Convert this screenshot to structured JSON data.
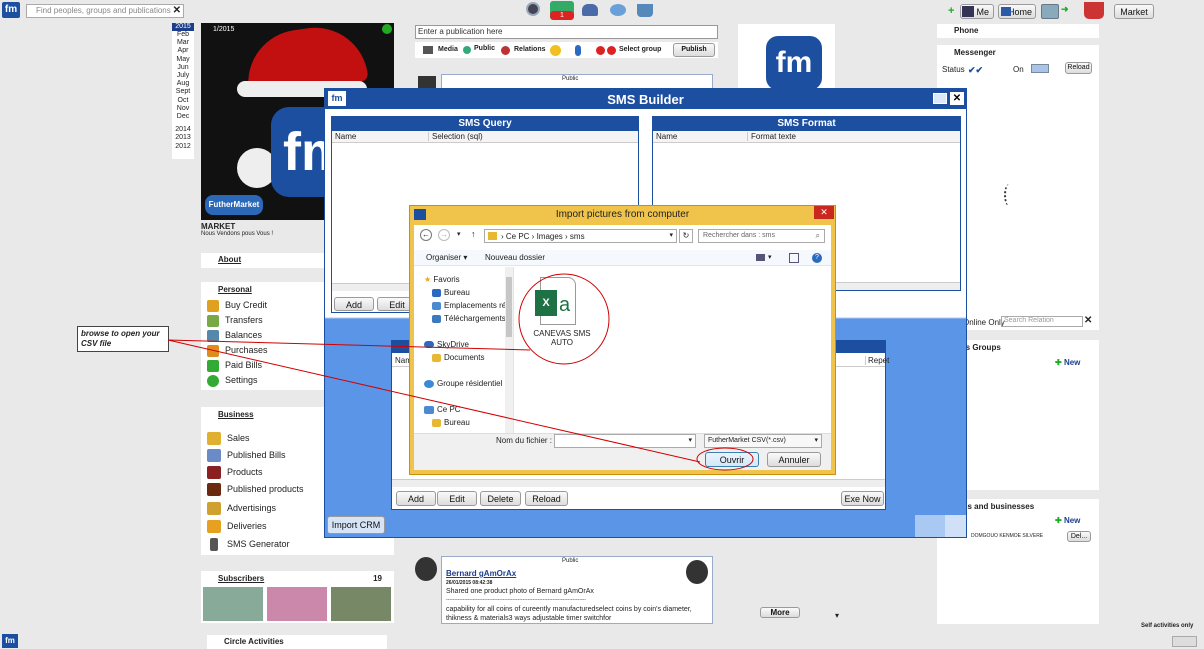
{
  "topbar": {
    "search_placeholder": "Find peoples, groups and publications",
    "close": "✕",
    "notif_count": "1",
    "me": "Me",
    "home": "Home",
    "market": "Market"
  },
  "years": {
    "active": "2015",
    "months": [
      "Feb",
      "Mar",
      "Apr",
      "May",
      "Jun",
      "July",
      "Aug",
      "Sept",
      "Oct",
      "Nov",
      "Dec"
    ],
    "past": [
      "2014",
      "2013",
      "2012"
    ]
  },
  "profile": {
    "date_badge": "1/2015",
    "logo_text": "fm",
    "brand": "FutherMarket",
    "name": "MARKET",
    "tagline": "Nous Vendons pous Vous !"
  },
  "left": {
    "about": "About",
    "personal_title": "Personal",
    "personal": [
      "Buy Credit",
      "Transfers",
      "Balances",
      "Purchases",
      "Paid Bills",
      "Settings"
    ],
    "business_title": "Business",
    "business": [
      "Sales",
      "Published Bills",
      "Products",
      "Published products",
      "Advertisings",
      "Deliveries",
      "SMS Generator"
    ],
    "subscribers_title": "Subscribers",
    "subscribers_count": "19",
    "circle": "Circle Activities"
  },
  "annotation": {
    "text": "browse to open your CSV file"
  },
  "composer": {
    "placeholder": "Enter a publication here",
    "media": "Media",
    "public": "Public",
    "relations": "Relations",
    "select_group": "Select group",
    "publish": "Publish"
  },
  "posts": {
    "visibility": "Public",
    "author": "Bernard gAmOrAx",
    "date": "26/01/2015 08:42:38",
    "line1": "Shared one product photo of  Bernard gAmOrAx",
    "rule": "------------------------------------------------------------------------------------",
    "body": "capability for all coins of cureently manufacturedselect coins by coin's diameter, thikness & materials3 ways adjustable timer switchfor",
    "more": "More"
  },
  "right": {
    "phone": "Phone",
    "messenger": "Messenger",
    "status": "Status",
    "on": "On",
    "reload": "Reload",
    "online_only": "Online Only",
    "search_relation": "Search Relation",
    "groups": "ts Groups",
    "new": "New",
    "pages": "es and businesses",
    "person": "DOMGOUO KENMOE SILVERE",
    "del": "Del...",
    "self": "Self activities only"
  },
  "sms_builder": {
    "title": "SMS Builder",
    "logo": "fm",
    "query": {
      "title": "SMS Query",
      "columns": [
        "Name",
        "Selection (sql)"
      ],
      "add": "Add",
      "edit": "Edit"
    },
    "format": {
      "title": "SMS Format",
      "columns": [
        "Name",
        "Format texte"
      ]
    },
    "bottom": {
      "columns": [
        "Nam",
        "Repet"
      ],
      "add": "Add",
      "edit": "Edit",
      "delete": "Delete",
      "reload": "Reload",
      "exe": "Exe Now"
    },
    "import_crm": "Import CRM"
  },
  "file_dialog": {
    "title": "Import pictures from computer",
    "path": [
      "Ce PC",
      "Images",
      "sms"
    ],
    "search_placeholder": "Rechercher dans : sms",
    "organiser": "Organiser ▾",
    "new_folder": "Nouveau dossier",
    "nav": [
      {
        "label": "Favoris",
        "type": "star",
        "indent": 0
      },
      {
        "label": "Bureau",
        "type": "folder-blue",
        "indent": 1
      },
      {
        "label": "Emplacements ré",
        "type": "folder",
        "indent": 1
      },
      {
        "label": "Téléchargements",
        "type": "folder",
        "indent": 1
      },
      {
        "label": "SkyDrive",
        "type": "cloud",
        "indent": 0
      },
      {
        "label": "Documents",
        "type": "folder",
        "indent": 1
      },
      {
        "label": "Groupe résidentiel",
        "type": "group",
        "indent": 0
      },
      {
        "label": "Ce PC",
        "type": "pc",
        "indent": 0
      },
      {
        "label": "Bureau",
        "type": "folder",
        "indent": 1
      }
    ],
    "file": {
      "name": "CANEVAS SMS AUTO",
      "icon": "excel-file-icon"
    },
    "filename_label": "Nom du fichier :",
    "filename_value": "",
    "filetype": "FutherMarket CSV(*.csv)",
    "open": "Ouvrir",
    "cancel": "Annuler"
  },
  "colors": {
    "brand_blue": "#1c4fa0",
    "dialog_border": "#e5a832",
    "close_red": "#c8281e",
    "annotation_red": "#d00000"
  }
}
